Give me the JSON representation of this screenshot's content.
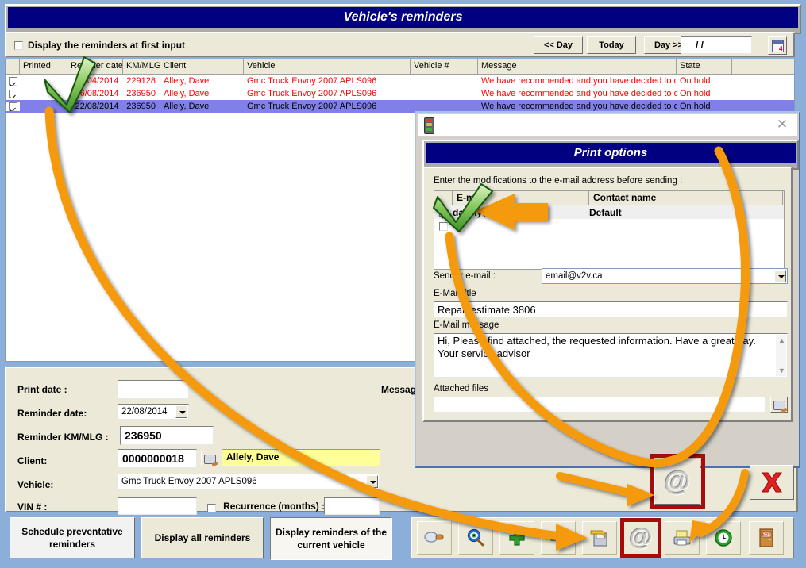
{
  "window": {
    "title": "Vehicle's reminders",
    "display_first_input_label": "Display the reminders at first input",
    "nav": {
      "prev_day": "<< Day",
      "today": "Today",
      "next_day": "Day >>",
      "date_value": "/  /",
      "calendar_icon": "calendar-icon"
    }
  },
  "grid": {
    "columns": [
      "",
      "Printed",
      "Remider date",
      "KM/MLG",
      "Client",
      "Vehicle",
      "Vehicle #",
      "Message",
      "State"
    ],
    "rows": [
      {
        "checked": true,
        "printed": "",
        "date": "01/04/2014",
        "km": "229128",
        "client": "Allely, Dave",
        "vehicle": "Gmc Truck Envoy 2007 APLS096",
        "vehicle_no": "",
        "message": "We have recommended and you have decided to del",
        "state": "On hold",
        "selected": false
      },
      {
        "checked": true,
        "printed": "",
        "date": "16/08/2014",
        "km": "236950",
        "client": "Allely, Dave",
        "vehicle": "Gmc Truck Envoy 2007 APLS096",
        "vehicle_no": "",
        "message": "We have recommended and you have decided to del",
        "state": "On hold",
        "selected": false
      },
      {
        "checked": true,
        "printed": "",
        "date": "22/08/2014",
        "km": "236950",
        "client": "Allely, Dave",
        "vehicle": "Gmc Truck Envoy 2007 APLS096",
        "vehicle_no": "",
        "message": "We have recommended and you have decided to del",
        "state": "On hold",
        "selected": true
      }
    ]
  },
  "form": {
    "print_date_label": "Print date :",
    "print_date_value": "",
    "reminder_date_label": "Reminder date:",
    "reminder_date_value": "22/08/2014",
    "reminder_km_label": "Reminder KM/MLG :",
    "reminder_km_value": "236950",
    "client_label": "Client:",
    "client_number": "0000000018",
    "client_name": "Allely, Dave",
    "vehicle_label": "Vehicle:",
    "vehicle_value": "Gmc Truck Envoy 2007 APLS096",
    "vin_label": "VIN # :",
    "vin_value": "",
    "recurrence_label": "Recurrence (months) :",
    "recurrence_value": "",
    "message_label": "Messag"
  },
  "buttons": {
    "schedule_preventative": "Schedule preventative reminders",
    "display_all": "Display all reminders",
    "display_current_vehicle": "Display reminders of the current vehicle"
  },
  "toolbar_icons": [
    {
      "name": "preview-icon",
      "glyph": "preview"
    },
    {
      "name": "search-icon",
      "glyph": "search"
    },
    {
      "name": "add-icon",
      "glyph": "plus"
    },
    {
      "name": "remove-icon",
      "glyph": "minus"
    },
    {
      "name": "save-icon",
      "glyph": "save"
    },
    {
      "name": "email-icon",
      "glyph": "@"
    },
    {
      "name": "print-icon",
      "glyph": "printer"
    },
    {
      "name": "history-icon",
      "glyph": "clock"
    },
    {
      "name": "exit-icon",
      "glyph": "EXIT"
    }
  ],
  "dialog": {
    "caption_icon": "traffic-light-icon",
    "close_label": "✕",
    "title": "Print options",
    "hint": "Enter the modifications to the e-mail address before sending :",
    "email_grid": {
      "columns": [
        "",
        "E-mail",
        "Contact name"
      ],
      "rows": [
        {
          "checked": true,
          "email": "dallely@gmail.com",
          "contact": "Default"
        },
        {
          "checked": false,
          "email": "",
          "contact": ""
        }
      ]
    },
    "sender_label": "Sender e-mail :",
    "sender_value": "email@v2v.ca",
    "title_label": "E-Mail title",
    "title_value": "Repair estimate 3806",
    "message_label": "E-Mail message",
    "message_line1": "Hi, Please find attached, the requested information. Have a great day.",
    "message_line2": "Your service advisor",
    "attached_label": "Attached files",
    "attached_value": "",
    "send_icon": "@",
    "cancel_icon": "red-x"
  },
  "colors": {
    "desktop_blue": "#8CAFD9",
    "title_navy": "#000080",
    "panel_beige": "#ECE9D8",
    "row_red": "#FF0000",
    "row_selected": "#8080E8",
    "client_yellow": "#FFFF99",
    "annotation_orange": "#F59A11",
    "annotation_green": "#36A02C",
    "highlight_red": "#A80B0B"
  }
}
